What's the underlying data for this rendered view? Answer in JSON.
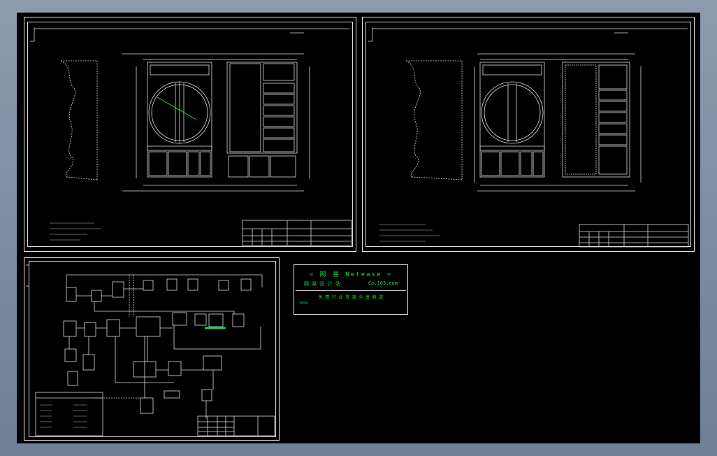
{
  "viewer": {
    "background": "#000000",
    "line_color": "#e0e0e0",
    "highlight_color": "#18e638"
  },
  "sheets": [
    {
      "id": "layout-plan-1"
    },
    {
      "id": "layout-plan-2"
    },
    {
      "id": "process-flow"
    }
  ],
  "watermark": {
    "line1": "=  网  易  Netease  =",
    "line2_left": "网 易 设 计 站",
    "line2_right": "Co.163.com",
    "line3": "免 费 行 业 资 源 分 享 频 道",
    "line4": "网易提供 ... ... ... ... ... ... ... ...",
    "line5": "... ... ... ... ... ... ... ... ..."
  }
}
